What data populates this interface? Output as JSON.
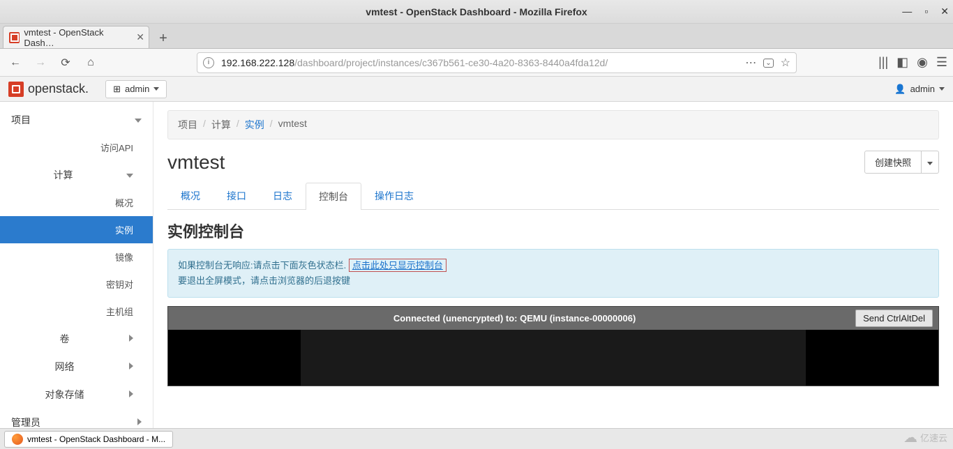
{
  "window": {
    "title": "vmtest - OpenStack Dashboard - Mozilla Firefox"
  },
  "browser_tab": {
    "label": "vmtest - OpenStack Dash…"
  },
  "url": {
    "host": "192.168.222.128",
    "path": "/dashboard/project/instances/c367b561-ce30-4a20-8363-8440a4fda12d/"
  },
  "topbar": {
    "brand": "openstack.",
    "project": "admin",
    "user": "admin"
  },
  "sidebar": {
    "project": "项目",
    "api": "访问API",
    "compute": "计算",
    "compute_items": {
      "overview": "概况",
      "instances": "实例",
      "images": "镜像",
      "keypairs": "密钥对",
      "server_groups": "主机组"
    },
    "volumes": "卷",
    "network": "网络",
    "object_store": "对象存储",
    "admin": "管理员"
  },
  "breadcrumb": {
    "project": "项目",
    "compute": "计算",
    "instances": "实例",
    "current": "vmtest"
  },
  "page": {
    "title": "vmtest",
    "snapshot_btn": "创建快照"
  },
  "tabs": {
    "overview": "概况",
    "interfaces": "接口",
    "log": "日志",
    "console": "控制台",
    "action_log": "操作日志"
  },
  "console": {
    "heading": "实例控制台",
    "hint1_pre": "如果控制台无响应:请点击下面灰色状态栏. ",
    "hint1_link": "点击此处只显示控制台",
    "hint2": "要退出全屏模式，请点击浏览器的后退按键",
    "status": "Connected (unencrypted) to: QEMU (instance-00000006)",
    "send_cad": "Send CtrlAltDel"
  },
  "taskbar": {
    "app": "vmtest - OpenStack Dashboard - M..."
  },
  "watermark": "亿速云"
}
